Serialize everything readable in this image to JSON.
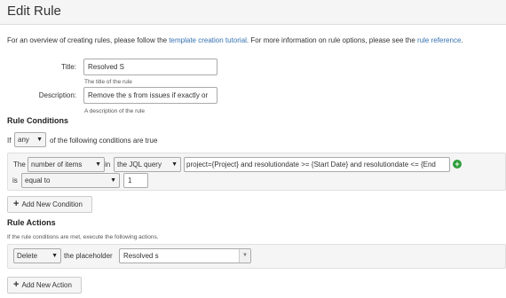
{
  "header": {
    "title": "Edit Rule"
  },
  "intro": {
    "text1": "For an overview of creating rules, please follow the ",
    "link1": "template creation tutorial",
    "text2": ". For more information on rule options, please see the ",
    "link2": "rule reference",
    "text3": "."
  },
  "form": {
    "title_label": "Title:",
    "title_value": "Resolved S",
    "title_help": "The title of the rule",
    "description_label": "Description:",
    "description_value": "Remove the s from issues if exactly or",
    "description_help": "A description of the rule"
  },
  "conditions": {
    "heading": "Rule Conditions",
    "if_text": "If",
    "match_value": "any",
    "following_text": "of the following conditions are true",
    "row": {
      "the_text": "The",
      "measure": "number of items",
      "in_text": "in",
      "source": "the JQL query",
      "query": "project={Project} and resolutiondate >= {Start Date} and resolutiondate <= {End",
      "is_text": "is",
      "operator": "equal to",
      "value": "1"
    },
    "add_button": "Add New Condition"
  },
  "actions": {
    "heading": "Rule Actions",
    "help": "If the rule conditions are met, execute the following actions.",
    "row": {
      "action": "Delete",
      "placeholder_text": "the placeholder",
      "placeholder_value": "Resolved s"
    },
    "add_button": "Add New Action"
  },
  "icons": {
    "add": "plus-icon",
    "add_condition": "green-plus-circle-icon",
    "dropdown": "caret-down-icon"
  }
}
